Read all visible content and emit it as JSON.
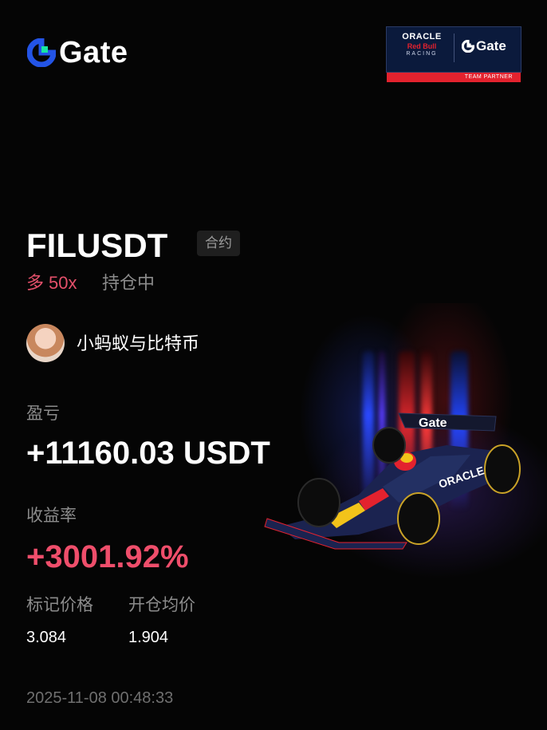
{
  "brand": {
    "name": "Gate",
    "logo_icon": "gate-logo-icon"
  },
  "partner_badge": {
    "line1": "ORACLE",
    "line2": "Red Bull",
    "line3": "RACING",
    "brand": "Gate",
    "footer": "TEAM PARTNER"
  },
  "position": {
    "symbol": "FILUSDT",
    "type_badge": "合约",
    "side": "多",
    "leverage": "50x",
    "status": "持仓中"
  },
  "user": {
    "name": "小蚂蚁与比特币",
    "avatar_icon": "avatar"
  },
  "pnl": {
    "label": "盈亏",
    "value": "+11160.03 USDT"
  },
  "roi": {
    "label": "收益率",
    "value": "+3001.92%"
  },
  "prices": {
    "mark_label": "标记价格",
    "mark_value": "3.084",
    "entry_label": "开仓均价",
    "entry_value": "1.904"
  },
  "timestamp": "2025-11-08 00:48:33",
  "car_livery": "ORACLE",
  "car_wing": "Gate",
  "colors": {
    "background": "#050505",
    "long": "#e4506a",
    "roi": "#ef4e6b",
    "muted": "#8c8c8c",
    "brand_blue": "#2354e6",
    "brand_green": "#17e6a1",
    "partner_red": "#e3222e"
  }
}
